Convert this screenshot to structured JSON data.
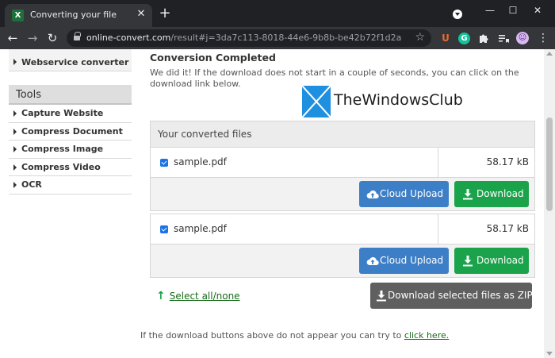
{
  "browser": {
    "tab_title": "Converting your file",
    "tab_favicon": "X",
    "new_tab": "+",
    "tab_close": "✕",
    "url_host": "online-convert.com",
    "url_path": "/result#j=3da7c113-8018-44e6-9b8b-be42b72f1d2a",
    "window_controls": {
      "minimize": "—",
      "maximize": "☐",
      "close": "✕"
    },
    "extensions": {
      "u": "U",
      "g": "G"
    }
  },
  "sidebar": {
    "top_item": "Webservice converter",
    "tools_heading": "Tools",
    "tools": [
      {
        "label": "Capture Website"
      },
      {
        "label": "Compress Document"
      },
      {
        "label": "Compress Image"
      },
      {
        "label": "Compress Video"
      },
      {
        "label": "OCR"
      }
    ]
  },
  "main": {
    "title": "Conversion Completed",
    "description": "We did it! If the download does not start in a couple of seconds, you can click on the download link below.",
    "watermark": "TheWindowsClub",
    "files_heading": "Your converted files",
    "files": [
      {
        "name": "sample.pdf",
        "size": "58.17 kB",
        "checked": true
      },
      {
        "name": "sample.pdf",
        "size": "58.17 kB",
        "checked": true
      }
    ],
    "cloud_upload_label": "Cloud Upload",
    "download_label": "Download",
    "select_all_label": "Select all/none",
    "zip_label": "Download selected files as ZIP",
    "footnote_text": "If the download buttons above do not appear you can try to ",
    "footnote_link": "click here."
  },
  "colors": {
    "cloud_button": "#3d7fc7",
    "download_button": "#1aa34a",
    "zip_button": "#5f5f5f",
    "link_green": "#1a6b1a"
  },
  "icons": [
    "excel-favicon-icon",
    "lock-icon",
    "star-icon",
    "cloud-upload-icon",
    "download-icon",
    "windows-logo-icon",
    "up-arrow-icon"
  ]
}
